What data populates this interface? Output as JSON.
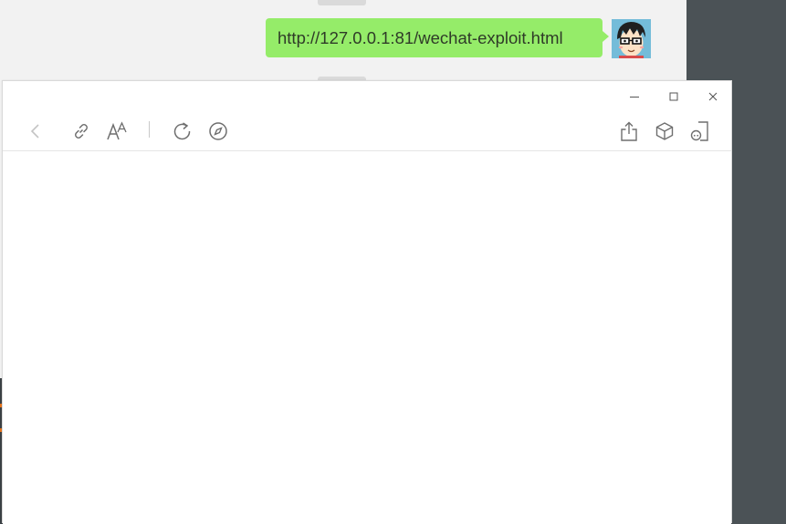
{
  "chat": {
    "message_text": "http://127.0.0.1:81/wechat-exploit.html",
    "bubble_color": "#95ec69",
    "avatar_icon": "cartoon-avatar-with-glasses"
  },
  "colors": {
    "chat_background": "#f2f2f2",
    "side_panel": "#4b5256",
    "window_background": "#ffffff",
    "icon_stroke": "#6e6e6e",
    "icon_disabled": "#c4c4c4"
  },
  "window_controls": {
    "minimize_icon": "minimize-icon",
    "maximize_icon": "maximize-icon",
    "close_icon": "close-icon"
  },
  "toolbar": {
    "left": [
      "back-icon",
      "copy-link-icon",
      "font-size-icon",
      "refresh-icon",
      "open-in-browser-icon"
    ],
    "right": [
      "share-icon",
      "mini-program-cube-icon",
      "floating-window-icon"
    ]
  }
}
